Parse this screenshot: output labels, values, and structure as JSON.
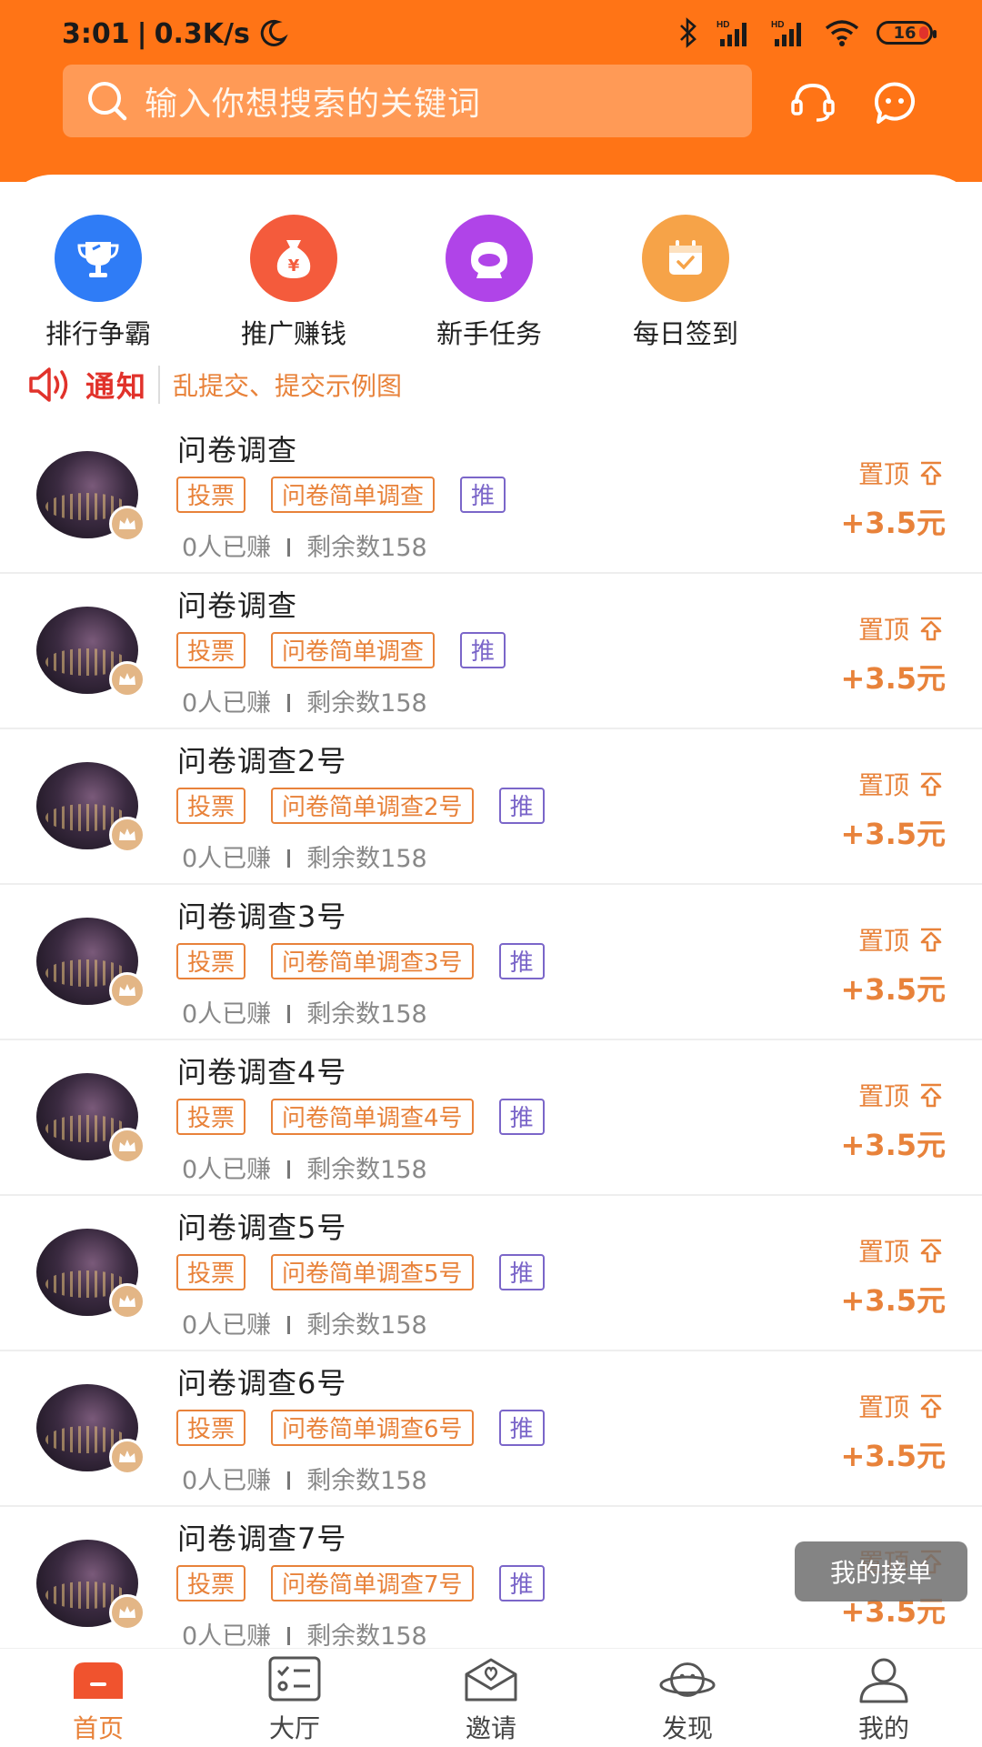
{
  "status_bar": {
    "time": "3:01",
    "speed": "0.3K/s",
    "battery": "16"
  },
  "search": {
    "placeholder": "输入你想搜索的关键词"
  },
  "quick_actions": [
    {
      "label": "排行争霸",
      "icon": "trophy-icon",
      "color": "#2F7CF6"
    },
    {
      "label": "推广赚钱",
      "icon": "money-bag-icon",
      "color": "#F45B3C"
    },
    {
      "label": "新手任务",
      "icon": "chat-bubble-icon",
      "color": "#B044E8"
    },
    {
      "label": "每日签到",
      "icon": "calendar-check-icon",
      "color": "#F6A348"
    }
  ],
  "notice": {
    "title": "通知",
    "text": "乱提交、提交示例图"
  },
  "tasks": [
    {
      "title": "问卷调查",
      "tag1": "投票",
      "tag2": "问卷简单调查",
      "tag3": "推",
      "earned": "0人已赚",
      "remaining": "剩余数158",
      "pin": "置顶",
      "reward": "+3.5元"
    },
    {
      "title": "问卷调查",
      "tag1": "投票",
      "tag2": "问卷简单调查",
      "tag3": "推",
      "earned": "0人已赚",
      "remaining": "剩余数158",
      "pin": "置顶",
      "reward": "+3.5元"
    },
    {
      "title": "问卷调查2号",
      "tag1": "投票",
      "tag2": "问卷简单调查2号",
      "tag3": "推",
      "earned": "0人已赚",
      "remaining": "剩余数158",
      "pin": "置顶",
      "reward": "+3.5元"
    },
    {
      "title": "问卷调查3号",
      "tag1": "投票",
      "tag2": "问卷简单调查3号",
      "tag3": "推",
      "earned": "0人已赚",
      "remaining": "剩余数158",
      "pin": "置顶",
      "reward": "+3.5元"
    },
    {
      "title": "问卷调查4号",
      "tag1": "投票",
      "tag2": "问卷简单调查4号",
      "tag3": "推",
      "earned": "0人已赚",
      "remaining": "剩余数158",
      "pin": "置顶",
      "reward": "+3.5元"
    },
    {
      "title": "问卷调查5号",
      "tag1": "投票",
      "tag2": "问卷简单调查5号",
      "tag3": "推",
      "earned": "0人已赚",
      "remaining": "剩余数158",
      "pin": "置顶",
      "reward": "+3.5元"
    },
    {
      "title": "问卷调查6号",
      "tag1": "投票",
      "tag2": "问卷简单调查6号",
      "tag3": "推",
      "earned": "0人已赚",
      "remaining": "剩余数158",
      "pin": "置顶",
      "reward": "+3.5元"
    },
    {
      "title": "问卷调查7号",
      "tag1": "投票",
      "tag2": "问卷简单调查7号",
      "tag3": "推",
      "earned": "0人已赚",
      "remaining": "剩余数158",
      "pin": "置顶",
      "reward": "+3.5元"
    }
  ],
  "float_button": "我的接单",
  "tabs": [
    {
      "label": "首页",
      "icon": "home-icon",
      "active": true
    },
    {
      "label": "大厅",
      "icon": "checklist-icon",
      "active": false
    },
    {
      "label": "邀请",
      "icon": "invite-envelope-icon",
      "active": false
    },
    {
      "label": "发现",
      "icon": "discover-planet-icon",
      "active": false
    },
    {
      "label": "我的",
      "icon": "user-icon",
      "active": false
    }
  ],
  "colors": {
    "brand": "#FF7416",
    "accent": "#E8823A",
    "notice_red": "#E1322B",
    "push_tag": "#7B66C9"
  }
}
